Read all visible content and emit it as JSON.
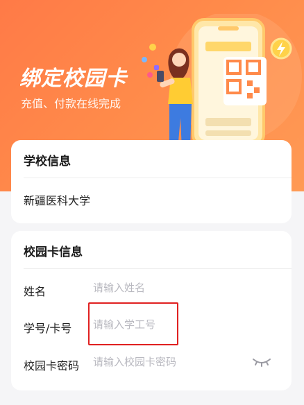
{
  "banner": {
    "title": "绑定校园卡",
    "subtitle": "充值、付款在线完成"
  },
  "school_section": {
    "title": "学校信息",
    "school_name": "新疆医科大学"
  },
  "campus_card_section": {
    "title": "校园卡信息",
    "fields": [
      {
        "label": "姓名",
        "placeholder": "请输入姓名"
      },
      {
        "label": "学号/卡号",
        "placeholder": "请输入学工号"
      },
      {
        "label": "校园卡密码",
        "placeholder": "请输入校园卡密码"
      }
    ]
  },
  "colors": {
    "banner_orange": "#ff8a4a",
    "highlight_red": "#e02020",
    "placeholder_gray": "#b9b9c0"
  },
  "icons": {
    "password_visibility": "eye-closed-icon",
    "coin": "lightning-coin-icon",
    "qr": "qr-code-icon"
  }
}
